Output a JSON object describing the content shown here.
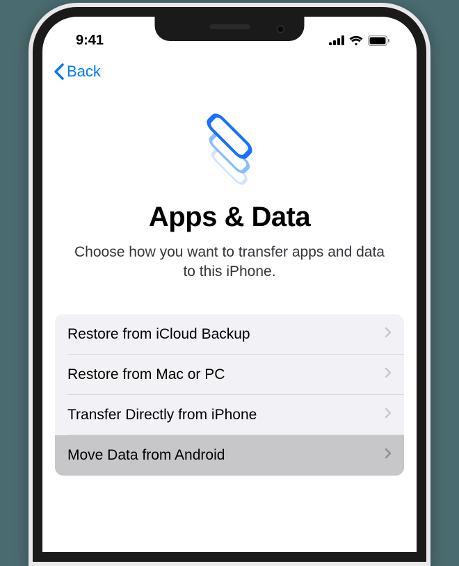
{
  "status": {
    "time": "9:41"
  },
  "nav": {
    "back_label": "Back"
  },
  "page": {
    "title": "Apps & Data",
    "subtitle": "Choose how you want to transfer apps and data to this iPhone."
  },
  "options": [
    {
      "label": "Restore from iCloud Backup",
      "selected": false
    },
    {
      "label": "Restore from Mac or PC",
      "selected": false
    },
    {
      "label": "Transfer Directly from iPhone",
      "selected": false
    },
    {
      "label": "Move Data from Android",
      "selected": true
    }
  ],
  "colors": {
    "accent": "#007aff",
    "option_bg": "#f2f2f6",
    "selected_bg": "#c7c7c9"
  }
}
